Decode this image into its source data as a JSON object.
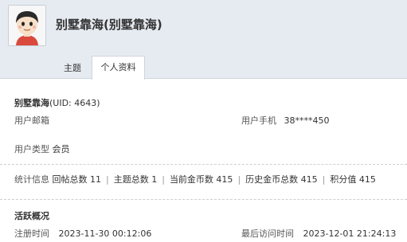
{
  "profile": {
    "display_title": "别墅靠海(别墅靠海)"
  },
  "tabs": {
    "topics": "主题",
    "profile": "个人资料"
  },
  "info": {
    "name": "别墅靠海",
    "uid_text": "(UID: 4643)",
    "email_label": "用户邮箱",
    "email_value": "",
    "phone_label": "用户手机",
    "phone_value": "38****450",
    "type_label": "用户类型",
    "type_value": "会员"
  },
  "stats": {
    "label": "统计信息",
    "posts": "回帖总数 11",
    "threads": "主题总数 1",
    "coins": "当前金币数 415",
    "history_coins": "历史金币总数 415",
    "points": "积分值 415",
    "separator": "|"
  },
  "activity": {
    "title": "活跃概况",
    "register_label": "注册时间",
    "register_value": "2023-11-30 00:12:06",
    "last_visit_label": "最后访问时间",
    "last_visit_value": "2023-12-01 21:24:13"
  },
  "colors": {
    "header_bg": "#e6ebf2",
    "border": "#cdd5df"
  }
}
